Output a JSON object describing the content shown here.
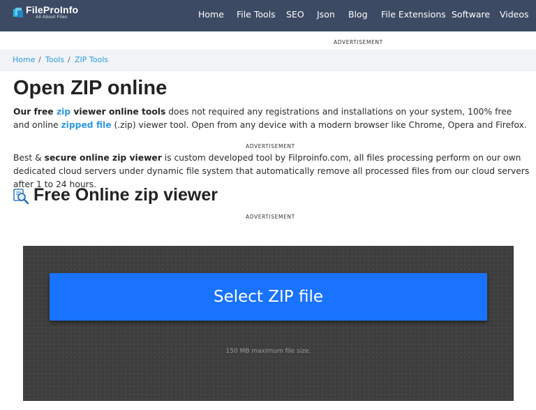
{
  "navbar": {
    "logo_name": "FileProInfo",
    "logo_tagline": "All About Files",
    "items": [
      "Home",
      "File Tools",
      "SEO",
      "Json",
      "Blog",
      "File Extensions",
      "Software",
      "Videos"
    ]
  },
  "ads": {
    "label": "ADVERTISEMENT"
  },
  "breadcrumb": {
    "items": [
      "Home",
      "Tools",
      "ZIP Tools"
    ],
    "separator": "/"
  },
  "page": {
    "title": "Open ZIP online",
    "p1": {
      "t1": "Our free ",
      "t2": "zip",
      "t3": " viewer online tools",
      "t4": " does not required any registrations and installations on your system, 100% free and online ",
      "t5": "zipped file",
      "t6": " (.zip) viewer tool. Open from any device with a modern browser like Chrome, Opera and Firefox."
    },
    "p2": {
      "t1": "Best & ",
      "t2": "secure online zip viewer",
      "t3": " is custom developed tool by Filproinfo.com, all files processing perform on our own dedicated cloud servers under dynamic file system that automatically remove all processed files from our cloud servers after 1 to 24 hours."
    },
    "section_title": "Free Online zip viewer"
  },
  "upload": {
    "button_label": "Select ZIP file",
    "max_size_note": "150 MB maximum file size."
  },
  "colors": {
    "navbar_bg": "#3c4a63",
    "link": "#2f99de",
    "button": "#1a73ff",
    "upload_bg": "#3e3e3e"
  },
  "icons": {
    "logo": "fileproinfo-logo-icon",
    "section": "search-document-icon"
  }
}
